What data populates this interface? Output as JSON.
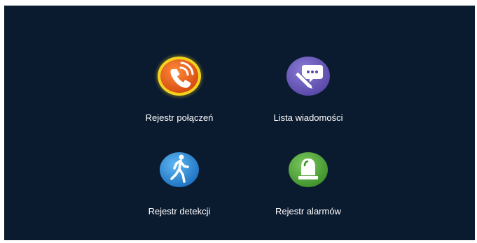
{
  "menu": {
    "items": [
      {
        "label": "Rejestr połączeń",
        "icon": "phone-call-icon",
        "color": "#e8631e",
        "selected": true
      },
      {
        "label": "Lista wiadomości",
        "icon": "message-pencil-icon",
        "color": "#6a5bb8",
        "selected": false
      },
      {
        "label": "Rejestr detekcji",
        "icon": "walking-person-icon",
        "color": "#2c8fd6",
        "selected": false
      },
      {
        "label": "Rejestr alarmów",
        "icon": "alarm-siren-icon",
        "color": "#4fa83a",
        "selected": false
      }
    ]
  },
  "theme": {
    "background": "#0b1b2f",
    "selection_glow": "#f2d21c"
  }
}
